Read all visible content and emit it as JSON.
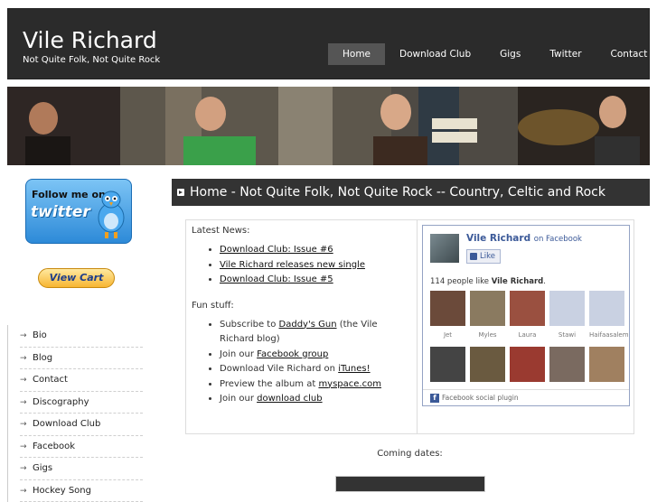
{
  "header": {
    "title": "Vile Richard",
    "tagline": "Not Quite Folk, Not Quite Rock"
  },
  "nav": {
    "items": [
      {
        "label": "Home",
        "active": true
      },
      {
        "label": "Download Club"
      },
      {
        "label": "Gigs"
      },
      {
        "label": "Twitter"
      },
      {
        "label": "Contact Us"
      }
    ]
  },
  "sidebar": {
    "twitter_badge": {
      "line1": "Follow me on",
      "line2": "twitter"
    },
    "view_cart": "View Cart",
    "items": [
      {
        "label": "Bio"
      },
      {
        "label": "Blog"
      },
      {
        "label": "Contact"
      },
      {
        "label": "Discography"
      },
      {
        "label": "Download Club"
      },
      {
        "label": "Facebook"
      },
      {
        "label": "Gigs"
      },
      {
        "label": "Hockey Song"
      }
    ]
  },
  "main": {
    "heading": "Home - Not Quite Folk, Not Quite Rock -- Country, Celtic and Rock",
    "news_label": "Latest News:",
    "news": [
      {
        "label": "Download Club: Issue #6"
      },
      {
        "label": "Vile Richard releases new single"
      },
      {
        "label": "Download Club: Issue #5"
      }
    ],
    "fun_label": "Fun stuff:",
    "fun": [
      {
        "before": "Subscribe  to ",
        "link": "Daddy's Gun",
        "after": " (the Vile Richard blog)"
      },
      {
        "before": "Join our ",
        "link": "Facebook group",
        "after": ""
      },
      {
        "before": "Download Vile Richard on ",
        "link": "iTunes!",
        "after": ""
      },
      {
        "before": "Preview the album at ",
        "link": "myspace.com",
        "after": ""
      },
      {
        "before": "Join our ",
        "link": "download club",
        "after": ""
      }
    ],
    "coming_dates": "Coming dates:"
  },
  "facebook": {
    "page_name": "Vile Richard",
    "on_facebook": "on Facebook",
    "like_label": "Like",
    "count_text": "114 people like ",
    "count_name": "Vile Richard",
    "count_end": ".",
    "fans": [
      {
        "name": "Jet",
        "color": "#6b4a3a"
      },
      {
        "name": "Myles",
        "color": "#8a7a60"
      },
      {
        "name": "Laura",
        "color": "#9a5040"
      },
      {
        "name": "Stawi",
        "color": "#c9d1e2"
      },
      {
        "name": "Haifaasalem",
        "color": "#c9d1e2"
      },
      {
        "name": "",
        "color": "#444"
      },
      {
        "name": "",
        "color": "#6a5a40"
      },
      {
        "name": "",
        "color": "#9a3a30"
      },
      {
        "name": "",
        "color": "#7a6a60"
      },
      {
        "name": "",
        "color": "#a08060"
      }
    ],
    "plugin_label": "Facebook social plugin"
  },
  "colors": {
    "header_bg": "#2b2b2b",
    "heading_bg": "#333333",
    "facebook_blue": "#3b5998"
  }
}
